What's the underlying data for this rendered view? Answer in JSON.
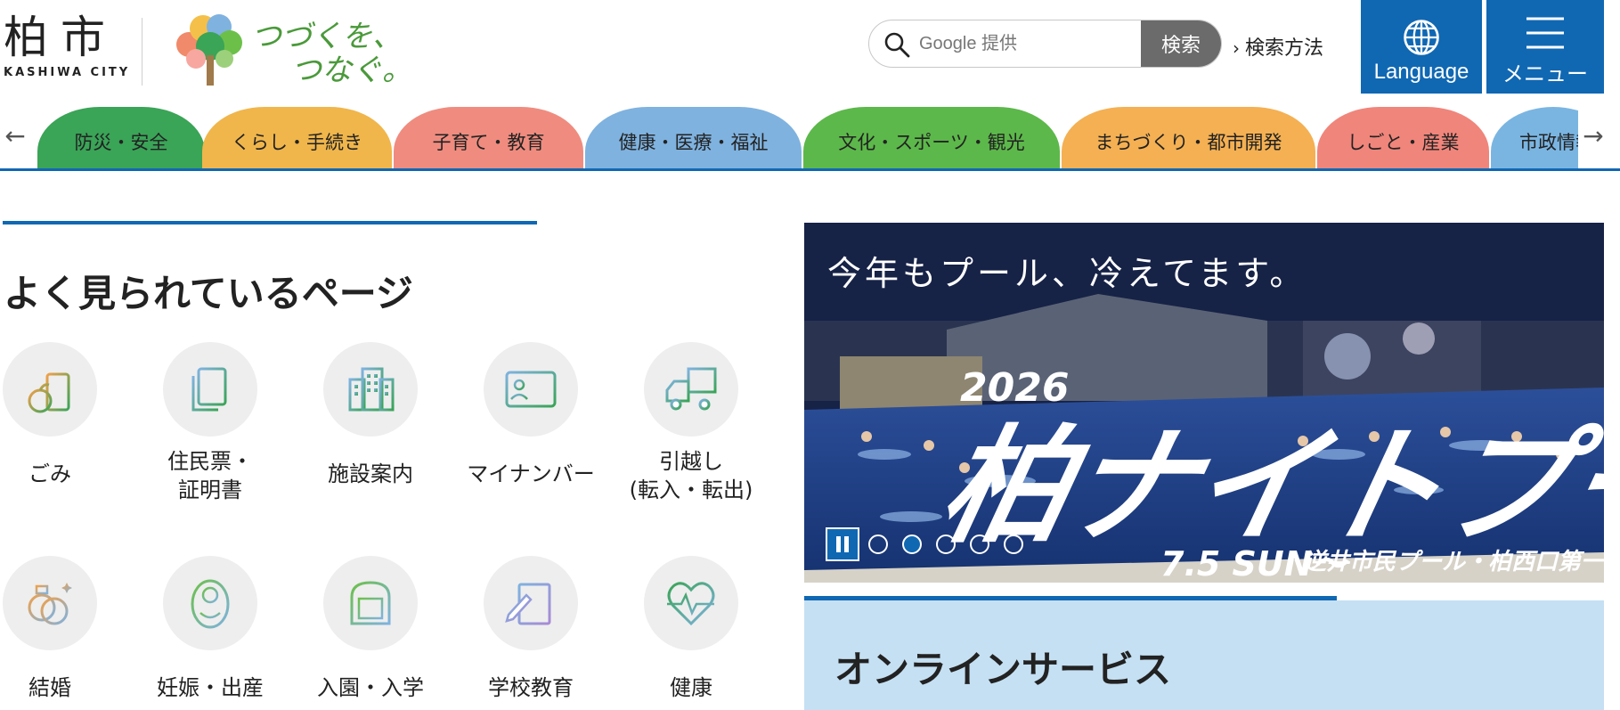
{
  "header": {
    "logo_kanji": "柏市",
    "logo_en": "KASHIWA CITY",
    "slogan_line1": "つづくを、",
    "slogan_line2": "つなぐ。",
    "search_placeholder": "Google 提供",
    "search_button": "検索",
    "search_help": "検索方法",
    "language_label": "Language",
    "menu_label": "メニュー"
  },
  "nav": {
    "prev_icon": "arrow-left-icon",
    "next_icon": "arrow-right-icon",
    "categories": [
      {
        "label": "防災・安全",
        "color": "#3aa457"
      },
      {
        "label": "くらし・手続き",
        "color": "#f0b64b"
      },
      {
        "label": "子育て・教育",
        "color": "#ef8c7f"
      },
      {
        "label": "健康・医療・福祉",
        "color": "#7fb2df"
      },
      {
        "label": "文化・スポーツ・観光",
        "color": "#5cb84a"
      },
      {
        "label": "まちづくり・都市開発",
        "color": "#f4b052"
      },
      {
        "label": "しごと・産業",
        "color": "#f0857b"
      },
      {
        "label": "市政情報",
        "color": "#7ab5e2"
      }
    ]
  },
  "popular": {
    "title": "よく見られているページ",
    "items": [
      {
        "label": "ごみ",
        "icon": "trash-icon"
      },
      {
        "label": "住民票・\n証明書",
        "icon": "document-icon"
      },
      {
        "label": "施設案内",
        "icon": "building-icon"
      },
      {
        "label": "マイナンバー",
        "icon": "id-card-icon"
      },
      {
        "label": "引越し\n(転入・転出)",
        "icon": "truck-icon"
      },
      {
        "label": "結婚",
        "icon": "rings-icon"
      },
      {
        "label": "妊娠・出産",
        "icon": "baby-icon"
      },
      {
        "label": "入園・入学",
        "icon": "school-bag-icon"
      },
      {
        "label": "学校教育",
        "icon": "pen-paper-icon"
      },
      {
        "label": "健康",
        "icon": "heart-pulse-icon"
      }
    ]
  },
  "banner": {
    "caption": "今年もプール、冷えてます。",
    "year": "2026",
    "headline": "柏ナイトプール",
    "date": "7.5 SUN〜",
    "venue": "逆井市民プール・柏西口第一公園市民プール",
    "slide_count": 5,
    "active_slide": 2
  },
  "online": {
    "title": "オンラインサービス"
  },
  "colors": {
    "accent": "#1068b3",
    "online_bg": "#c5e0f3",
    "search_button": "#6b6b6b"
  }
}
